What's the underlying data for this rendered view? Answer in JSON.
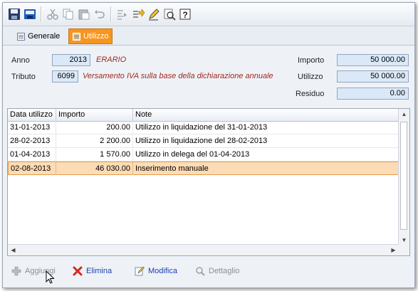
{
  "toolbar": {
    "icons": [
      "save-icon",
      "save-as-icon",
      "cut-icon",
      "copy-icon",
      "paste-icon",
      "undo-icon",
      "indent-icon",
      "export-icon",
      "edit-icon",
      "preview-icon",
      "help-icon"
    ]
  },
  "tabs": [
    {
      "label": "Generale",
      "active": false
    },
    {
      "label": "Utilizzo",
      "active": true
    }
  ],
  "form": {
    "anno_label": "Anno",
    "anno_value": "2013",
    "anno_desc": "ERARIO",
    "tributo_label": "Tributo",
    "tributo_value": "6099",
    "tributo_desc": "Versamento IVA sulla base della dichiarazione annuale",
    "importo_label": "Importo",
    "importo_value": "50 000.00",
    "utilizzo_label": "Utilizzo",
    "utilizzo_value": "50 000.00",
    "residuo_label": "Residuo",
    "residuo_value": "0.00"
  },
  "grid": {
    "columns": [
      "Data utilizzo",
      "Importo",
      "Note"
    ],
    "rows": [
      {
        "data": "31-01-2013",
        "importo": "200.00",
        "note": "Utilizzo in liquidazione del 31-01-2013",
        "selected": false
      },
      {
        "data": "28-02-2013",
        "importo": "2 200.00",
        "note": "Utilizzo in liquidazione del 28-02-2013",
        "selected": false
      },
      {
        "data": "01-04-2013",
        "importo": "1 570.00",
        "note": "Utilizzo in delega del 01-04-2013",
        "selected": false
      },
      {
        "data": "02-08-2013",
        "importo": "46 030.00",
        "note": "Inserimento manuale",
        "selected": true
      }
    ]
  },
  "actions": {
    "aggiungi": "Aggiungi",
    "elimina": "Elimina",
    "modifica": "Modifica",
    "dettaglio": "Dettaglio"
  },
  "colors": {
    "accent": "#f7961e",
    "selected_row": "#fbdcb6",
    "field_bg": "#dbe8f7",
    "desc_red": "#a0281e",
    "link_blue": "#1a3fb0"
  }
}
